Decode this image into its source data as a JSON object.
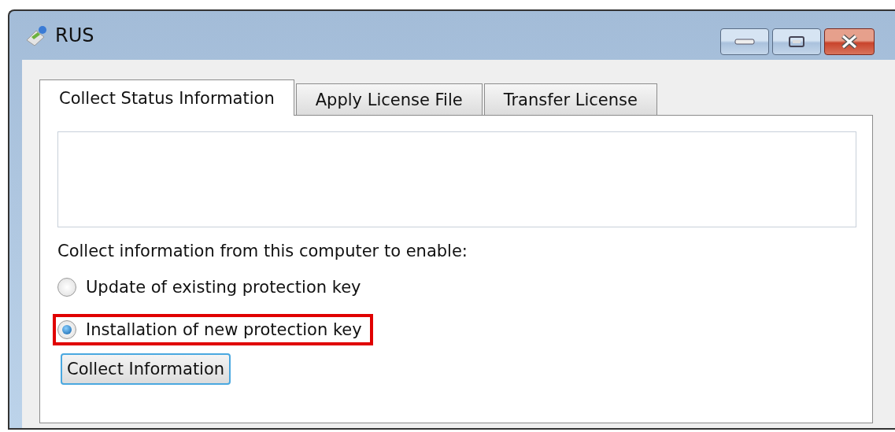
{
  "window": {
    "title": "RUS"
  },
  "tabs": [
    {
      "label": "Collect Status Information",
      "selected": true
    },
    {
      "label": "Apply License File",
      "selected": false
    },
    {
      "label": "Transfer License",
      "selected": false
    }
  ],
  "prompt": "Collect information from this computer to enable:",
  "options": [
    {
      "label": "Update of existing protection key",
      "selected": false,
      "highlighted": false
    },
    {
      "label": "Installation of new protection key",
      "selected": true,
      "highlighted": true
    }
  ],
  "buttons": [
    "Collect Information"
  ]
}
